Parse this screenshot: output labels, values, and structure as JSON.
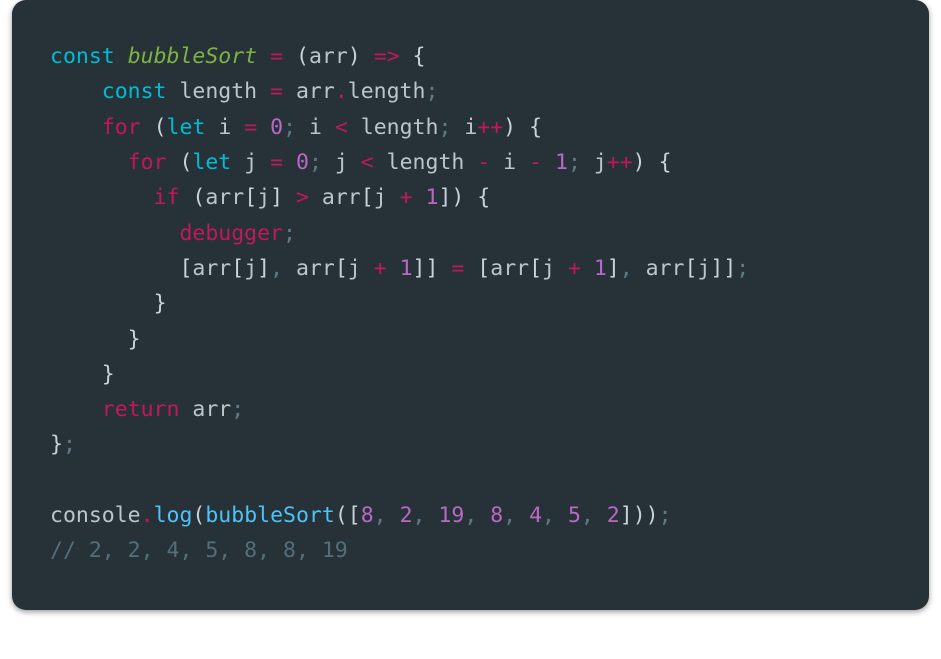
{
  "code": {
    "tokens": [
      [
        {
          "c": "tok-keyword",
          "t": "const"
        },
        {
          "c": "tok-ident",
          "t": " "
        },
        {
          "c": "tok-def",
          "t": "bubbleSort"
        },
        {
          "c": "tok-ident",
          "t": " "
        },
        {
          "c": "tok-op",
          "t": "="
        },
        {
          "c": "tok-ident",
          "t": " "
        },
        {
          "c": "tok-paren",
          "t": "("
        },
        {
          "c": "tok-ident",
          "t": "arr"
        },
        {
          "c": "tok-paren",
          "t": ")"
        },
        {
          "c": "tok-ident",
          "t": " "
        },
        {
          "c": "tok-op",
          "t": "=>"
        },
        {
          "c": "tok-ident",
          "t": " "
        },
        {
          "c": "tok-paren",
          "t": "{"
        }
      ],
      [
        {
          "c": "tok-ident",
          "t": "    "
        },
        {
          "c": "tok-keyword",
          "t": "const"
        },
        {
          "c": "tok-ident",
          "t": " length "
        },
        {
          "c": "tok-op",
          "t": "="
        },
        {
          "c": "tok-ident",
          "t": " arr"
        },
        {
          "c": "tok-op",
          "t": "."
        },
        {
          "c": "tok-ident",
          "t": "length"
        },
        {
          "c": "tok-punct",
          "t": ";"
        }
      ],
      [
        {
          "c": "tok-ident",
          "t": "    "
        },
        {
          "c": "tok-ctrl",
          "t": "for"
        },
        {
          "c": "tok-ident",
          "t": " "
        },
        {
          "c": "tok-paren",
          "t": "("
        },
        {
          "c": "tok-keyword",
          "t": "let"
        },
        {
          "c": "tok-ident",
          "t": " i "
        },
        {
          "c": "tok-op",
          "t": "="
        },
        {
          "c": "tok-ident",
          "t": " "
        },
        {
          "c": "tok-num",
          "t": "0"
        },
        {
          "c": "tok-punct",
          "t": ";"
        },
        {
          "c": "tok-ident",
          "t": " i "
        },
        {
          "c": "tok-op",
          "t": "<"
        },
        {
          "c": "tok-ident",
          "t": " length"
        },
        {
          "c": "tok-punct",
          "t": ";"
        },
        {
          "c": "tok-ident",
          "t": " i"
        },
        {
          "c": "tok-op",
          "t": "++"
        },
        {
          "c": "tok-paren",
          "t": ")"
        },
        {
          "c": "tok-ident",
          "t": " "
        },
        {
          "c": "tok-paren",
          "t": "{"
        }
      ],
      [
        {
          "c": "tok-ident",
          "t": "      "
        },
        {
          "c": "tok-ctrl",
          "t": "for"
        },
        {
          "c": "tok-ident",
          "t": " "
        },
        {
          "c": "tok-paren",
          "t": "("
        },
        {
          "c": "tok-keyword",
          "t": "let"
        },
        {
          "c": "tok-ident",
          "t": " j "
        },
        {
          "c": "tok-op",
          "t": "="
        },
        {
          "c": "tok-ident",
          "t": " "
        },
        {
          "c": "tok-num",
          "t": "0"
        },
        {
          "c": "tok-punct",
          "t": ";"
        },
        {
          "c": "tok-ident",
          "t": " j "
        },
        {
          "c": "tok-op",
          "t": "<"
        },
        {
          "c": "tok-ident",
          "t": " length "
        },
        {
          "c": "tok-op",
          "t": "-"
        },
        {
          "c": "tok-ident",
          "t": " i "
        },
        {
          "c": "tok-op",
          "t": "-"
        },
        {
          "c": "tok-ident",
          "t": " "
        },
        {
          "c": "tok-num",
          "t": "1"
        },
        {
          "c": "tok-punct",
          "t": ";"
        },
        {
          "c": "tok-ident",
          "t": " j"
        },
        {
          "c": "tok-op",
          "t": "++"
        },
        {
          "c": "tok-paren",
          "t": ")"
        },
        {
          "c": "tok-ident",
          "t": " "
        },
        {
          "c": "tok-paren",
          "t": "{"
        }
      ],
      [
        {
          "c": "tok-ident",
          "t": "        "
        },
        {
          "c": "tok-ctrl",
          "t": "if"
        },
        {
          "c": "tok-ident",
          "t": " "
        },
        {
          "c": "tok-paren",
          "t": "("
        },
        {
          "c": "tok-ident",
          "t": "arr"
        },
        {
          "c": "tok-paren",
          "t": "["
        },
        {
          "c": "tok-ident",
          "t": "j"
        },
        {
          "c": "tok-paren",
          "t": "]"
        },
        {
          "c": "tok-ident",
          "t": " "
        },
        {
          "c": "tok-op",
          "t": ">"
        },
        {
          "c": "tok-ident",
          "t": " arr"
        },
        {
          "c": "tok-paren",
          "t": "["
        },
        {
          "c": "tok-ident",
          "t": "j "
        },
        {
          "c": "tok-op",
          "t": "+"
        },
        {
          "c": "tok-ident",
          "t": " "
        },
        {
          "c": "tok-num",
          "t": "1"
        },
        {
          "c": "tok-paren",
          "t": "])"
        },
        {
          "c": "tok-ident",
          "t": " "
        },
        {
          "c": "tok-paren",
          "t": "{"
        }
      ],
      [
        {
          "c": "tok-ident",
          "t": "          "
        },
        {
          "c": "tok-ctrl",
          "t": "debugger"
        },
        {
          "c": "tok-punct",
          "t": ";"
        }
      ],
      [
        {
          "c": "tok-ident",
          "t": "          "
        },
        {
          "c": "tok-paren",
          "t": "["
        },
        {
          "c": "tok-ident",
          "t": "arr"
        },
        {
          "c": "tok-paren",
          "t": "["
        },
        {
          "c": "tok-ident",
          "t": "j"
        },
        {
          "c": "tok-paren",
          "t": "]"
        },
        {
          "c": "tok-punct",
          "t": ","
        },
        {
          "c": "tok-ident",
          "t": " arr"
        },
        {
          "c": "tok-paren",
          "t": "["
        },
        {
          "c": "tok-ident",
          "t": "j "
        },
        {
          "c": "tok-op",
          "t": "+"
        },
        {
          "c": "tok-ident",
          "t": " "
        },
        {
          "c": "tok-num",
          "t": "1"
        },
        {
          "c": "tok-paren",
          "t": "]]"
        },
        {
          "c": "tok-ident",
          "t": " "
        },
        {
          "c": "tok-op",
          "t": "="
        },
        {
          "c": "tok-ident",
          "t": " "
        },
        {
          "c": "tok-paren",
          "t": "["
        },
        {
          "c": "tok-ident",
          "t": "arr"
        },
        {
          "c": "tok-paren",
          "t": "["
        },
        {
          "c": "tok-ident",
          "t": "j "
        },
        {
          "c": "tok-op",
          "t": "+"
        },
        {
          "c": "tok-ident",
          "t": " "
        },
        {
          "c": "tok-num",
          "t": "1"
        },
        {
          "c": "tok-paren",
          "t": "]"
        },
        {
          "c": "tok-punct",
          "t": ","
        },
        {
          "c": "tok-ident",
          "t": " arr"
        },
        {
          "c": "tok-paren",
          "t": "["
        },
        {
          "c": "tok-ident",
          "t": "j"
        },
        {
          "c": "tok-paren",
          "t": "]]"
        },
        {
          "c": "tok-punct",
          "t": ";"
        }
      ],
      [
        {
          "c": "tok-ident",
          "t": "        "
        },
        {
          "c": "tok-paren",
          "t": "}"
        }
      ],
      [
        {
          "c": "tok-ident",
          "t": "      "
        },
        {
          "c": "tok-paren",
          "t": "}"
        }
      ],
      [
        {
          "c": "tok-ident",
          "t": "    "
        },
        {
          "c": "tok-paren",
          "t": "}"
        }
      ],
      [
        {
          "c": "tok-ident",
          "t": "    "
        },
        {
          "c": "tok-ctrl",
          "t": "return"
        },
        {
          "c": "tok-ident",
          "t": " arr"
        },
        {
          "c": "tok-punct",
          "t": ";"
        }
      ],
      [
        {
          "c": "tok-paren",
          "t": "}"
        },
        {
          "c": "tok-punct",
          "t": ";"
        }
      ],
      [
        {
          "c": "tok-ident",
          "t": " "
        }
      ],
      [
        {
          "c": "tok-ident",
          "t": "console"
        },
        {
          "c": "tok-op",
          "t": "."
        },
        {
          "c": "tok-call",
          "t": "log"
        },
        {
          "c": "tok-paren",
          "t": "("
        },
        {
          "c": "tok-call",
          "t": "bubbleSort"
        },
        {
          "c": "tok-paren",
          "t": "(["
        },
        {
          "c": "tok-num",
          "t": "8"
        },
        {
          "c": "tok-punct",
          "t": ","
        },
        {
          "c": "tok-ident",
          "t": " "
        },
        {
          "c": "tok-num",
          "t": "2"
        },
        {
          "c": "tok-punct",
          "t": ","
        },
        {
          "c": "tok-ident",
          "t": " "
        },
        {
          "c": "tok-num",
          "t": "19"
        },
        {
          "c": "tok-punct",
          "t": ","
        },
        {
          "c": "tok-ident",
          "t": " "
        },
        {
          "c": "tok-num",
          "t": "8"
        },
        {
          "c": "tok-punct",
          "t": ","
        },
        {
          "c": "tok-ident",
          "t": " "
        },
        {
          "c": "tok-num",
          "t": "4"
        },
        {
          "c": "tok-punct",
          "t": ","
        },
        {
          "c": "tok-ident",
          "t": " "
        },
        {
          "c": "tok-num",
          "t": "5"
        },
        {
          "c": "tok-punct",
          "t": ","
        },
        {
          "c": "tok-ident",
          "t": " "
        },
        {
          "c": "tok-num",
          "t": "2"
        },
        {
          "c": "tok-paren",
          "t": "]))"
        },
        {
          "c": "tok-punct",
          "t": ";"
        }
      ],
      [
        {
          "c": "tok-comment",
          "t": "// 2, 2, 4, 5, 8, 8, 19"
        }
      ]
    ]
  }
}
